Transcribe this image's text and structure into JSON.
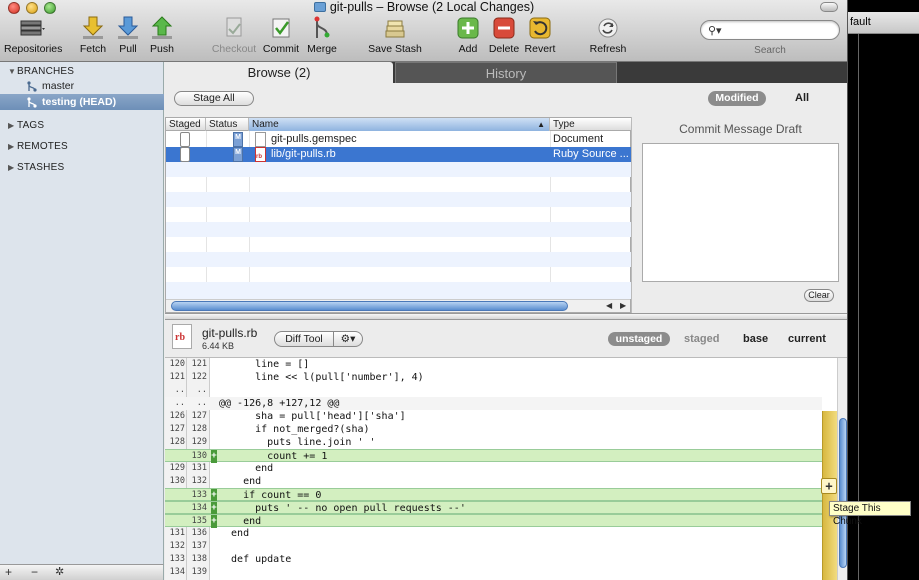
{
  "window": {
    "title": "git-pulls – Browse (2 Local Changes)"
  },
  "background_window": {
    "title_fragment": "fault"
  },
  "toolbar": {
    "repositories": "Repositories",
    "fetch": "Fetch",
    "pull": "Pull",
    "push": "Push",
    "checkout": "Checkout",
    "commit": "Commit",
    "merge": "Merge",
    "save_stash": "Save Stash",
    "add": "Add",
    "delete": "Delete",
    "revert": "Revert",
    "refresh": "Refresh",
    "search_label": "Search",
    "search_value": ""
  },
  "sidebar": {
    "branches_header": "BRANCHES",
    "branches": [
      {
        "name": "master",
        "selected": false
      },
      {
        "name": "testing (HEAD)",
        "selected": true
      }
    ],
    "tags": "TAGS",
    "remotes": "REMOTES",
    "stashes": "STASHES",
    "footer": {
      "add": "+",
      "remove": "−",
      "action": "✲"
    }
  },
  "tabs": {
    "browse": "Browse (2)",
    "history": "History"
  },
  "browse": {
    "stage_all": "Stage All",
    "filter_modified": "Modified",
    "filter_all": "All"
  },
  "files_table": {
    "columns": [
      "Staged",
      "Status",
      "Name",
      "Type"
    ],
    "sort_indicator": "▲",
    "rows": [
      {
        "staged": false,
        "status": "M",
        "name": "git-pulls.gemspec",
        "type": "Document",
        "selected": false
      },
      {
        "staged": false,
        "status": "M",
        "name": "lib/git-pulls.rb",
        "type": "Ruby Source ...",
        "selected": true
      }
    ]
  },
  "commit_pane": {
    "title": "Commit Message Draft",
    "message": "",
    "clear": "Clear"
  },
  "diff_header": {
    "filename": "git-pulls.rb",
    "filesize": "6.44 KB",
    "icon_label": "rb",
    "diff_tool": "Diff Tool",
    "views": {
      "unstaged": "unstaged",
      "staged": "staged",
      "base": "base",
      "current": "current"
    }
  },
  "diff_lines": [
    {
      "old": "120",
      "new": "121",
      "mark": "",
      "code": "      line = []",
      "kind": "ctx"
    },
    {
      "old": "121",
      "new": "122",
      "mark": "",
      "code": "      line << l(pull['number'], 4)",
      "kind": "ctx"
    },
    {
      "old": "..",
      "new": "..",
      "mark": "",
      "code": "",
      "kind": "ctx"
    },
    {
      "old": "..",
      "new": "..",
      "mark": "",
      "code": "@@ -126,8 +127,12 @@",
      "kind": "hunk"
    },
    {
      "old": "126",
      "new": "127",
      "mark": "",
      "code": "      sha = pull['head']['sha']",
      "kind": "ctx"
    },
    {
      "old": "127",
      "new": "128",
      "mark": "",
      "code": "      if not_merged?(sha)",
      "kind": "ctx"
    },
    {
      "old": "128",
      "new": "129",
      "mark": "",
      "code": "        puts line.join ' '",
      "kind": "ctx"
    },
    {
      "old": "",
      "new": "130",
      "mark": "+",
      "code": "        count += 1",
      "kind": "add"
    },
    {
      "old": "129",
      "new": "131",
      "mark": "",
      "code": "      end",
      "kind": "ctx"
    },
    {
      "old": "130",
      "new": "132",
      "mark": "",
      "code": "    end",
      "kind": "ctx"
    },
    {
      "old": "",
      "new": "133",
      "mark": "+",
      "code": "    if count == 0",
      "kind": "add"
    },
    {
      "old": "",
      "new": "134",
      "mark": "+",
      "code": "      puts ' -- no open pull requests --'",
      "kind": "add"
    },
    {
      "old": "",
      "new": "135",
      "mark": "+",
      "code": "    end",
      "kind": "add"
    },
    {
      "old": "131",
      "new": "136",
      "mark": "",
      "code": "  end",
      "kind": "ctx"
    },
    {
      "old": "132",
      "new": "137",
      "mark": "",
      "code": "",
      "kind": "ctx"
    },
    {
      "old": "133",
      "new": "138",
      "mark": "",
      "code": "  def update",
      "kind": "ctx"
    },
    {
      "old": "134",
      "new": "139",
      "mark": "",
      "code": "",
      "kind": "ctx"
    }
  ],
  "chunk": {
    "button": "+",
    "tooltip": "Stage This Chunk"
  },
  "colors": {
    "accent": "#3b76d0",
    "added_bg": "#d3efc0",
    "added_mark": "#4a9a3a",
    "chunk_bar": "#e8c850"
  }
}
